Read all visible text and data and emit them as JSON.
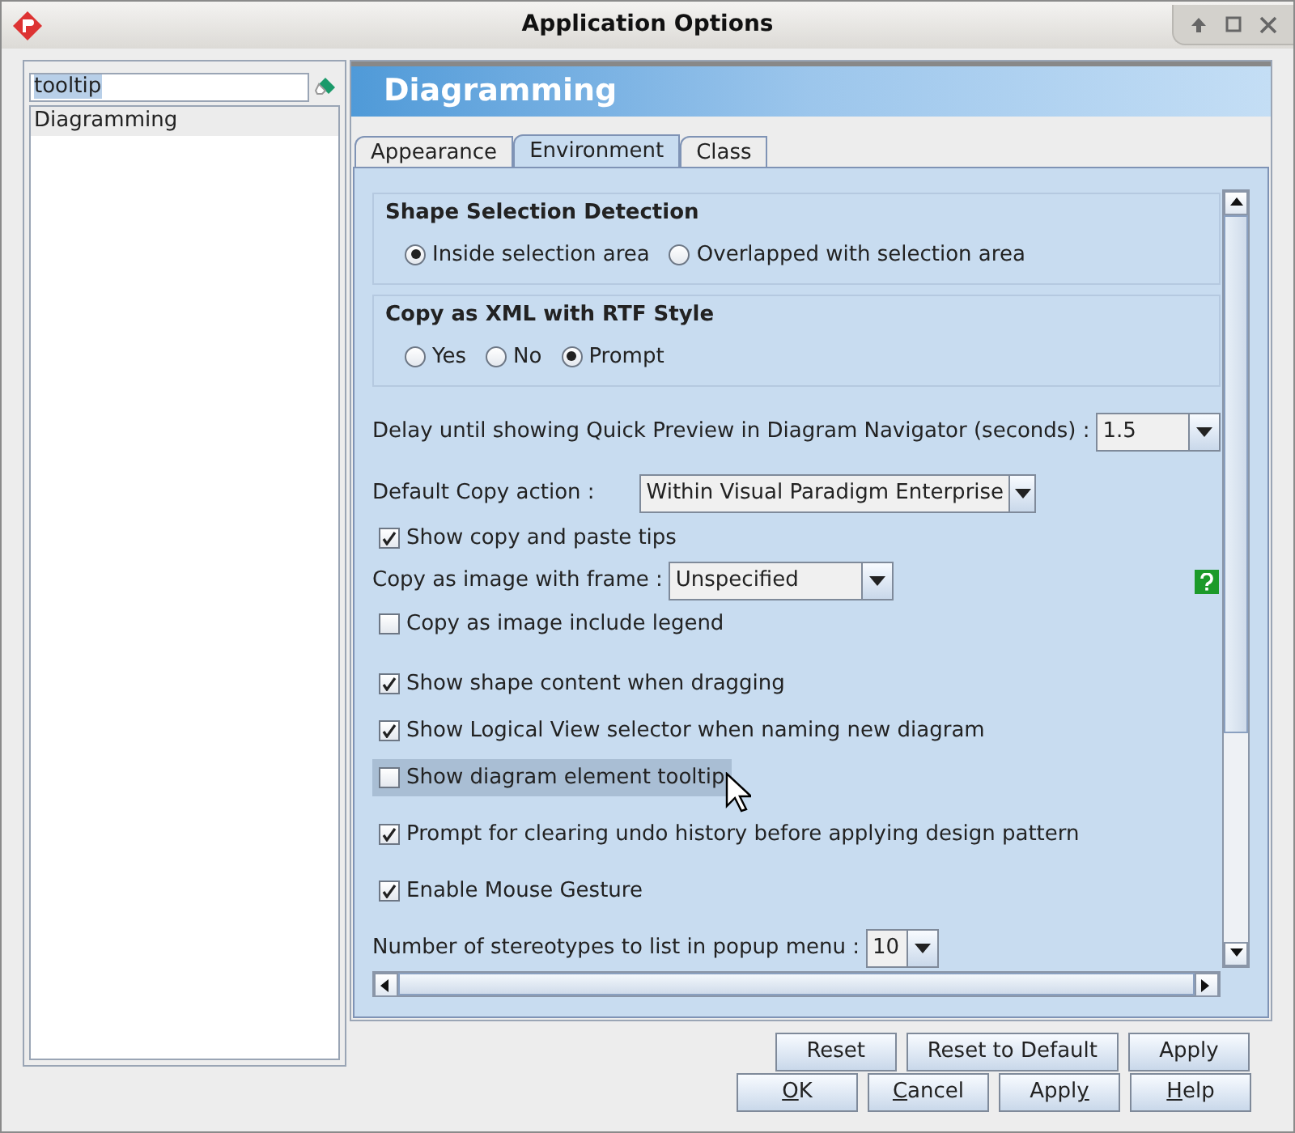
{
  "window": {
    "title": "Application Options"
  },
  "search": {
    "value": "tooltip"
  },
  "sidebar": {
    "items": [
      {
        "label": "Diagramming",
        "selected": true
      }
    ]
  },
  "header": {
    "title": "Diagramming"
  },
  "tabs": [
    {
      "label": "Appearance",
      "selected": false
    },
    {
      "label": "Environment",
      "selected": true
    },
    {
      "label": "Class",
      "selected": false
    }
  ],
  "settings": [
    {
      "kind": "group",
      "title": "Shape Selection Detection",
      "options": [
        {
          "label": "Inside selection area",
          "selected": true
        },
        {
          "label": "Overlapped with selection area",
          "selected": false
        }
      ]
    },
    {
      "kind": "group",
      "title": "Copy as XML with RTF Style",
      "options": [
        {
          "label": "Yes",
          "selected": false
        },
        {
          "label": "No",
          "selected": false
        },
        {
          "label": "Prompt",
          "selected": true
        }
      ]
    },
    {
      "kind": "dropdown",
      "label": "Delay until showing Quick Preview in Diagram Navigator (seconds) :",
      "value": "1.5"
    },
    {
      "kind": "dropdown",
      "label": "Default Copy action :",
      "value": "Within Visual Paradigm Enterprise"
    },
    {
      "kind": "checkbox",
      "label": "Show copy and paste tips",
      "checked": true,
      "hovered": false
    },
    {
      "kind": "dropdown",
      "label": "Copy as image with frame :",
      "value": "Unspecified",
      "help": true
    },
    {
      "kind": "checkbox",
      "label": "Copy as image include legend",
      "checked": false,
      "hovered": false
    },
    {
      "kind": "checkbox",
      "label": "Show shape content when dragging",
      "checked": true,
      "hovered": false
    },
    {
      "kind": "checkbox",
      "label": "Show Logical View selector when naming new diagram",
      "checked": true,
      "hovered": false
    },
    {
      "kind": "checkbox",
      "label": "Show diagram element tooltip",
      "checked": false,
      "hovered": true
    },
    {
      "kind": "checkbox",
      "label": "Prompt for clearing undo history before applying design pattern",
      "checked": true,
      "hovered": false
    },
    {
      "kind": "checkbox",
      "label": "Enable Mouse Gesture",
      "checked": true,
      "hovered": false
    },
    {
      "kind": "dropdown",
      "label": "Number of stereotypes to list in popup menu :",
      "value": "10"
    }
  ],
  "panel_buttons": [
    {
      "label": "Reset"
    },
    {
      "label": "Reset to Default"
    },
    {
      "label": "Apply"
    }
  ],
  "dialog_buttons": [
    {
      "label": "OK"
    },
    {
      "label": "Cancel"
    },
    {
      "label": "Apply"
    },
    {
      "label": "Help"
    }
  ]
}
